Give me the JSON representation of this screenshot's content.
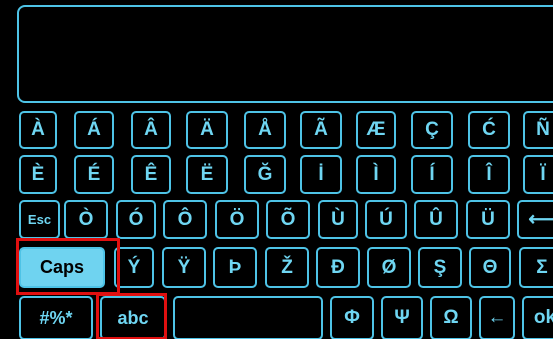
{
  "rows": {
    "row1": [
      "À",
      "Á",
      "Â",
      "Ä",
      "Å",
      "Ã",
      "Æ",
      "Ç",
      "Ć",
      "Ñ"
    ],
    "row2": [
      "È",
      "É",
      "Ê",
      "Ë",
      "Ğ",
      "İ",
      "Ì",
      "Í",
      "Î",
      "Ï"
    ],
    "row3": [
      "Esc",
      "Ò",
      "Ó",
      "Ô",
      "Ö",
      "Õ",
      "Ù",
      "Ú",
      "Û",
      "Ü",
      "⟵"
    ],
    "row4": [
      "Caps",
      "Ý",
      "Ÿ",
      "Þ",
      "Ž",
      "Đ",
      "Ø",
      "Ş",
      "Θ",
      "Σ"
    ],
    "row5": [
      "#%*",
      "abc",
      "",
      "Φ",
      "Ψ",
      "Ω",
      "←",
      "ok"
    ]
  },
  "colors": {
    "accent": "#4ec3e6",
    "key_text": "#6fd6f2",
    "caps_fill": "#6fd3f0",
    "highlight": "#e01010",
    "background": "#000000"
  }
}
